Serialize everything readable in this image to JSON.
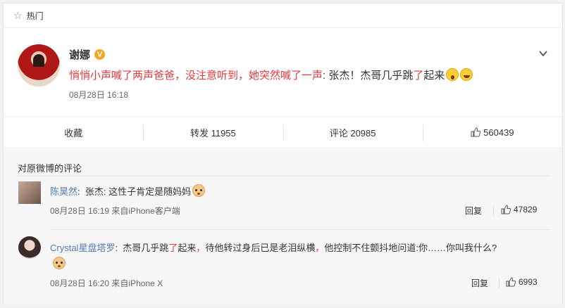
{
  "hot_bar": {
    "label": "热门"
  },
  "post": {
    "author": "谢娜",
    "badge": "V",
    "text_red": "悄悄小声喊了两声爸爸，没注意听到，她突然喊了一声",
    "text_mid": ": 张杰！杰哥几乎跳",
    "text_red2": "了",
    "text_end": "起来",
    "time": "08月28日 16:18"
  },
  "actions": {
    "collect": "收藏",
    "repost": "转发 11955",
    "comment": "评论 20985",
    "like": "560439"
  },
  "comments_section": {
    "title": "对原微博的评论",
    "items": [
      {
        "user": "陈昊然",
        "text": "张杰: 这性子肯定是随妈妈",
        "meta": "08月28日 16:19 来自iPhone客户端",
        "reply": "回复",
        "likes": "47829"
      },
      {
        "user": "Crystal星盘塔罗",
        "text_a": "杰哥几乎跳",
        "text_red": "了",
        "text_b": "起来",
        "text_red2": "，",
        "text_c": "待他转过身后已是老泪纵横",
        "text_red3": "，",
        "text_d": "他控制不住颤抖地问道:你……你叫我什么?",
        "meta": "08月28日 16:20 来自iPhone X",
        "reply": "回复",
        "likes": "6993"
      }
    ]
  },
  "icons": {
    "hot": "star-icon",
    "more": "chevron-down-icon",
    "like": "thumb-up-icon"
  },
  "colors": {
    "highlight": "#e4393c",
    "user_link": "#507daf",
    "badge": "#f7a623"
  }
}
